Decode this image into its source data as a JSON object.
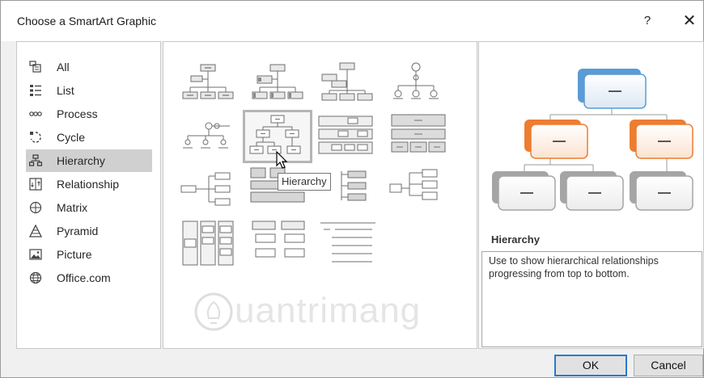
{
  "dialog": {
    "title": "Choose a SmartArt Graphic",
    "help_label": "?",
    "close_label": "✕"
  },
  "categories": [
    {
      "label": "All",
      "icon": "all-icon"
    },
    {
      "label": "List",
      "icon": "list-icon"
    },
    {
      "label": "Process",
      "icon": "process-icon"
    },
    {
      "label": "Cycle",
      "icon": "cycle-icon"
    },
    {
      "label": "Hierarchy",
      "icon": "hierarchy-icon"
    },
    {
      "label": "Relationship",
      "icon": "relationship-icon"
    },
    {
      "label": "Matrix",
      "icon": "matrix-icon"
    },
    {
      "label": "Pyramid",
      "icon": "pyramid-icon"
    },
    {
      "label": "Picture",
      "icon": "picture-icon"
    },
    {
      "label": "Office.com",
      "icon": "globe-icon"
    }
  ],
  "selected_category": "Hierarchy",
  "gallery": {
    "tooltip": "Hierarchy",
    "selected_layout": "Hierarchy"
  },
  "preview": {
    "title": "Hierarchy",
    "description": "Use to show hierarchical relationships progressing from top to bottom.",
    "colors": {
      "top": "#5b9bd5",
      "middle": "#ed7d31",
      "bottom": "#a5a5a5"
    }
  },
  "buttons": {
    "ok_label": "OK",
    "cancel_label": "Cancel"
  },
  "watermark": {
    "text": "uantrimang"
  }
}
